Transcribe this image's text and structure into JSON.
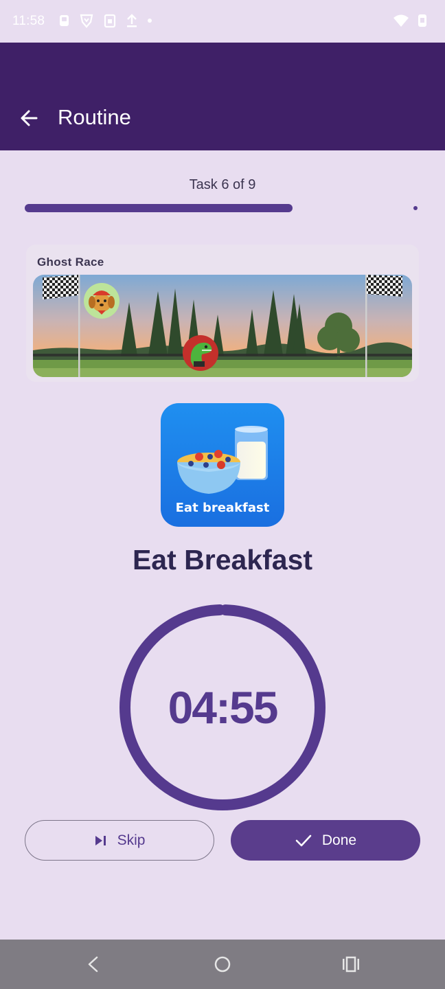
{
  "status_bar": {
    "time": "11:58",
    "left_icons": [
      "notification-icon",
      "brave-icon",
      "clipboard-icon",
      "upload-icon",
      "dot-icon"
    ],
    "right_icons": [
      "wifi-icon",
      "battery-icon"
    ]
  },
  "app_bar": {
    "title": "Routine",
    "back_icon": "arrow-left-icon"
  },
  "progress": {
    "label": "Task 6 of 9",
    "current": 6,
    "total": 9,
    "fraction": 0.68
  },
  "ghost_race": {
    "title": "Ghost Race"
  },
  "task": {
    "tile_caption": "Eat breakfast",
    "name": "Eat Breakfast"
  },
  "timer": {
    "value": "04:55",
    "fraction_remaining": 0.99
  },
  "actions": {
    "skip_label": "Skip",
    "done_label": "Done"
  },
  "nav": {
    "icons": [
      "back-nav-icon",
      "home-nav-icon",
      "recents-nav-icon"
    ]
  },
  "colors": {
    "app_bar": "#3f2067",
    "background": "#e8ddf0",
    "accent": "#553a8e"
  }
}
